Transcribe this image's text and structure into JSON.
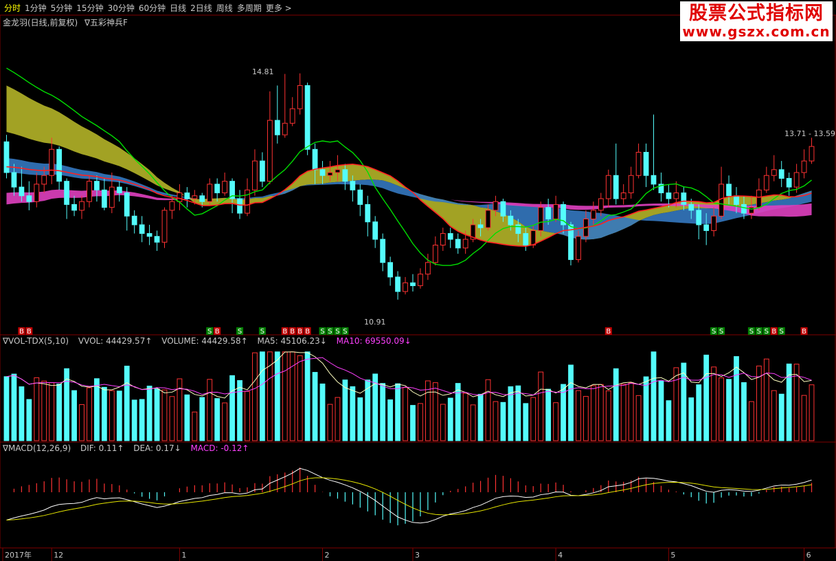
{
  "toolbar": {
    "items": [
      "分时",
      "1分钟",
      "5分钟",
      "15分钟",
      "30分钟",
      "60分钟",
      "日线",
      "2日线",
      "周线",
      "多周期",
      "更多 >"
    ],
    "active_index": 0
  },
  "watermark": {
    "title": "股票公式指标网",
    "url": "www.gszx.com.cn"
  },
  "main_title": {
    "stock": "金龙羽(日线,前复权)",
    "indicator": "∇五彩神兵F"
  },
  "price_labels": {
    "high": "14.81",
    "low": "10.91",
    "range": "13.71 - 13.59"
  },
  "vol_panel": {
    "name": "∇VOL-TDX(5,10)",
    "vvol": "VVOL: 44429.57↑",
    "volume": "VOLUME: 44429.58↑",
    "ma5": "MA5: 45106.23↓",
    "ma10": "MA10: 69550.09↓"
  },
  "macd_panel": {
    "name": "∇MACD(12,26,9)",
    "dif": "DIF: 0.11↑",
    "dea": "DEA: 0.17↓",
    "macd": "MACD: -0.12↑"
  },
  "colors": {
    "up": "#ff3232",
    "down": "#54fcfc",
    "ma_green": "#00e000",
    "ma_red": "#ff2020",
    "band_blue": "#3478c0",
    "band_magenta": "#e040c0",
    "band_olive": "#b4b428",
    "vol_ma5": "#ffffc0",
    "vol_ma10": "#ff40ff",
    "grid": "#800000"
  },
  "chart_data": {
    "type": "candlestick",
    "x_axis_labels": [
      {
        "label": "2017年",
        "i": 0
      },
      {
        "label": "12",
        "i": 6
      },
      {
        "label": "1",
        "i": 23
      },
      {
        "label": "2",
        "i": 42
      },
      {
        "label": "3",
        "i": 54
      },
      {
        "label": "4",
        "i": 73
      },
      {
        "label": "5",
        "i": 88
      },
      {
        "label": "6",
        "i": 106
      }
    ],
    "price_range": [
      10.6,
      15.6
    ],
    "candles": [
      [
        13.63,
        13.1,
        13.75,
        13.0
      ],
      [
        13.1,
        12.85,
        13.25,
        12.7
      ],
      [
        12.85,
        12.7,
        13.2,
        12.6
      ],
      [
        12.7,
        12.6,
        12.95,
        12.45
      ],
      [
        12.6,
        12.9,
        13.1,
        12.5
      ],
      [
        12.9,
        13.05,
        13.2,
        12.75
      ],
      [
        13.05,
        13.5,
        13.7,
        12.9
      ],
      [
        13.5,
        12.95,
        13.55,
        12.8
      ],
      [
        12.95,
        12.55,
        13.0,
        12.3
      ],
      [
        12.55,
        12.45,
        12.7,
        12.35
      ],
      [
        12.45,
        12.6,
        12.7,
        12.3
      ],
      [
        12.6,
        12.95,
        13.05,
        12.5
      ],
      [
        12.95,
        12.8,
        13.05,
        12.6
      ],
      [
        12.8,
        12.5,
        13.0,
        12.45
      ],
      [
        12.5,
        12.85,
        13.1,
        12.4
      ],
      [
        12.85,
        12.75,
        12.95,
        12.6
      ],
      [
        12.75,
        12.35,
        12.85,
        12.1
      ],
      [
        12.35,
        12.2,
        12.45,
        12.05
      ],
      [
        12.2,
        12.05,
        12.35,
        11.9
      ],
      [
        12.05,
        12.0,
        12.2,
        11.85
      ],
      [
        12.0,
        11.9,
        12.1,
        11.75
      ],
      [
        11.9,
        12.45,
        12.5,
        11.8
      ],
      [
        12.45,
        12.6,
        12.7,
        12.3
      ],
      [
        12.6,
        12.75,
        12.9,
        12.45
      ],
      [
        12.75,
        12.65,
        12.85,
        12.5
      ],
      [
        12.65,
        12.7,
        12.8,
        12.55
      ],
      [
        12.7,
        12.6,
        12.75,
        12.5
      ],
      [
        12.6,
        12.9,
        13.0,
        12.55
      ],
      [
        12.9,
        12.75,
        13.0,
        12.6
      ],
      [
        12.75,
        12.95,
        13.1,
        12.7
      ],
      [
        12.95,
        12.65,
        13.0,
        12.4
      ],
      [
        12.65,
        12.4,
        12.8,
        12.3
      ],
      [
        12.4,
        12.8,
        13.0,
        12.35
      ],
      [
        12.8,
        13.3,
        13.5,
        12.7
      ],
      [
        13.3,
        12.95,
        13.45,
        12.85
      ],
      [
        12.95,
        14.0,
        14.5,
        12.9
      ],
      [
        14.0,
        13.75,
        14.6,
        13.6
      ],
      [
        13.75,
        13.95,
        14.8,
        13.7
      ],
      [
        13.95,
        14.2,
        14.4,
        13.9
      ],
      [
        14.2,
        14.6,
        14.81,
        14.1
      ],
      [
        14.6,
        13.5,
        14.65,
        13.4
      ],
      [
        13.5,
        13.15,
        13.6,
        12.9
      ],
      [
        13.15,
        13.05,
        13.3,
        12.9
      ],
      [
        13.05,
        13.1,
        13.3,
        12.95
      ],
      [
        13.1,
        13.15,
        13.4,
        12.95
      ],
      [
        13.15,
        12.95,
        13.25,
        12.8
      ],
      [
        12.95,
        12.8,
        13.05,
        12.6
      ],
      [
        12.8,
        12.55,
        12.9,
        12.35
      ],
      [
        12.55,
        12.25,
        12.7,
        12.0
      ],
      [
        12.25,
        11.95,
        12.35,
        11.8
      ],
      [
        11.95,
        11.55,
        12.05,
        11.4
      ],
      [
        11.55,
        11.3,
        11.65,
        11.15
      ],
      [
        11.3,
        11.05,
        11.4,
        10.91
      ],
      [
        11.05,
        11.2,
        11.3,
        11.0
      ],
      [
        11.2,
        11.15,
        11.35,
        11.05
      ],
      [
        11.15,
        11.35,
        11.45,
        11.1
      ],
      [
        11.35,
        11.55,
        11.7,
        11.25
      ],
      [
        11.55,
        11.85,
        12.0,
        11.5
      ],
      [
        11.85,
        12.05,
        12.15,
        11.75
      ],
      [
        12.05,
        11.95,
        12.15,
        11.8
      ],
      [
        11.95,
        11.8,
        12.05,
        11.7
      ],
      [
        11.8,
        11.95,
        12.1,
        11.7
      ],
      [
        11.95,
        12.2,
        12.3,
        11.9
      ],
      [
        12.2,
        12.15,
        12.3,
        12.0
      ],
      [
        12.15,
        12.45,
        12.55,
        12.1
      ],
      [
        12.45,
        12.6,
        12.7,
        12.35
      ],
      [
        12.6,
        12.35,
        12.65,
        12.25
      ],
      [
        12.35,
        12.2,
        12.45,
        12.1
      ],
      [
        12.2,
        12.05,
        12.3,
        11.9
      ],
      [
        12.05,
        11.85,
        12.15,
        11.75
      ],
      [
        11.85,
        12.1,
        12.2,
        11.8
      ],
      [
        12.1,
        12.5,
        12.6,
        12.0
      ],
      [
        12.5,
        12.3,
        12.65,
        12.2
      ],
      [
        12.3,
        12.55,
        12.7,
        12.25
      ],
      [
        12.55,
        12.2,
        12.6,
        12.05
      ],
      [
        12.2,
        11.6,
        12.25,
        11.5
      ],
      [
        11.6,
        12.0,
        12.1,
        11.55
      ],
      [
        12.0,
        12.3,
        12.45,
        11.9
      ],
      [
        12.3,
        12.45,
        12.6,
        12.2
      ],
      [
        12.45,
        12.65,
        12.75,
        12.35
      ],
      [
        12.65,
        13.05,
        13.15,
        12.5
      ],
      [
        13.05,
        12.65,
        13.6,
        12.55
      ],
      [
        12.65,
        12.75,
        12.9,
        12.55
      ],
      [
        12.75,
        13.05,
        13.2,
        12.65
      ],
      [
        13.05,
        13.45,
        13.6,
        13.0
      ],
      [
        13.45,
        13.05,
        13.6,
        12.85
      ],
      [
        13.05,
        12.9,
        14.1,
        12.8
      ],
      [
        12.9,
        12.75,
        13.1,
        12.6
      ],
      [
        12.75,
        12.65,
        12.9,
        12.5
      ],
      [
        12.65,
        12.75,
        12.95,
        12.5
      ],
      [
        12.75,
        12.55,
        12.85,
        12.45
      ],
      [
        12.55,
        12.45,
        12.65,
        12.3
      ],
      [
        12.45,
        12.2,
        12.55,
        11.95
      ],
      [
        12.2,
        12.1,
        12.4,
        11.85
      ],
      [
        12.1,
        12.35,
        12.5,
        12.0
      ],
      [
        12.35,
        12.9,
        13.2,
        12.3
      ],
      [
        12.9,
        12.7,
        13.05,
        12.55
      ],
      [
        12.7,
        12.55,
        12.85,
        12.4
      ],
      [
        12.55,
        12.4,
        12.7,
        12.3
      ],
      [
        12.4,
        12.5,
        12.7,
        12.3
      ],
      [
        12.5,
        12.8,
        13.0,
        12.45
      ],
      [
        12.8,
        13.05,
        13.2,
        12.75
      ],
      [
        13.05,
        13.15,
        13.4,
        12.95
      ],
      [
        13.15,
        13.0,
        13.3,
        12.85
      ],
      [
        13.0,
        12.85,
        13.1,
        12.7
      ],
      [
        12.85,
        13.1,
        13.25,
        12.75
      ],
      [
        13.1,
        13.3,
        13.5,
        13.0
      ],
      [
        13.3,
        13.55,
        13.7,
        13.25
      ]
    ],
    "signals": [
      {
        "i": 2,
        "t": "B"
      },
      {
        "i": 3,
        "t": "B"
      },
      {
        "i": 27,
        "t": "S"
      },
      {
        "i": 28,
        "t": "B"
      },
      {
        "i": 31,
        "t": "S"
      },
      {
        "i": 34,
        "t": "S"
      },
      {
        "i": 37,
        "t": "B"
      },
      {
        "i": 38,
        "t": "B"
      },
      {
        "i": 39,
        "t": "B"
      },
      {
        "i": 40,
        "t": "B"
      },
      {
        "i": 42,
        "t": "S"
      },
      {
        "i": 43,
        "t": "S"
      },
      {
        "i": 44,
        "t": "S"
      },
      {
        "i": 45,
        "t": "S"
      },
      {
        "i": 80,
        "t": "B"
      },
      {
        "i": 94,
        "t": "S"
      },
      {
        "i": 95,
        "t": "S"
      },
      {
        "i": 99,
        "t": "S"
      },
      {
        "i": 100,
        "t": "S"
      },
      {
        "i": 101,
        "t": "S"
      },
      {
        "i": 102,
        "t": "B"
      },
      {
        "i": 103,
        "t": "S"
      },
      {
        "i": 106,
        "t": "B"
      }
    ],
    "vol_range": [
      0,
      140000
    ],
    "macd_range": [
      -0.9,
      0.6
    ]
  }
}
